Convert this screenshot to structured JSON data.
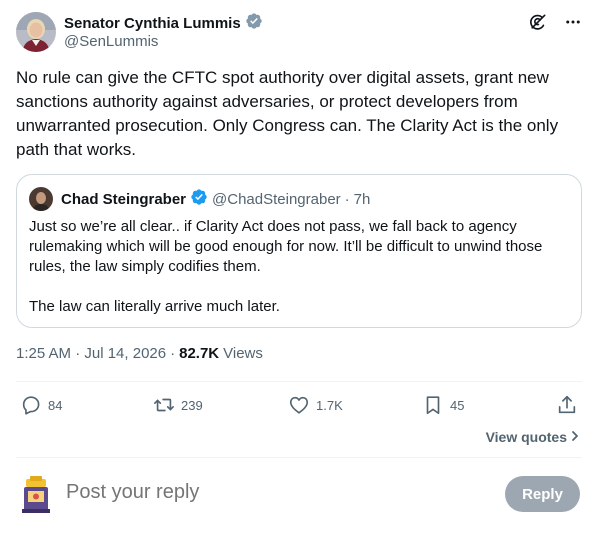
{
  "author": {
    "name": "Senator Cynthia Lummis",
    "handle": "@SenLummis"
  },
  "tweet": {
    "text": "No rule can give the CFTC spot authority over digital assets, grant new sanctions authority against adversaries, or protect developers from unwarranted prosecution. Only Congress can. The Clarity Act is the only path that works."
  },
  "quote": {
    "name": "Chad Steingraber",
    "handle": "@ChadSteingraber",
    "separator": "·",
    "time": "7h",
    "paragraph1": "Just so we’re all clear.. if Clarity Act does not pass, we fall back to agency rulemaking which will be good enough for now.  It’ll be difficult to unwind those rules, the law simply codifies them.",
    "paragraph2": "The law can literally arrive much later."
  },
  "meta": {
    "timestamp": "1:25 AM · Jul 14, 2026",
    "separator": "·",
    "views_count": "82.7K",
    "views_label": "Views"
  },
  "actions": {
    "replies": "84",
    "reposts": "239",
    "likes": "1.7K",
    "bookmarks": "45",
    "view_quotes": "View quotes"
  },
  "reply": {
    "placeholder": "Post your reply",
    "button_label": "Reply"
  },
  "colors": {
    "verified_badge_gray": "#829aab",
    "verified_badge_blue": "#1d9bf0",
    "secondary_text": "#536471",
    "border": "#cfd9de"
  },
  "icons": {
    "grok": "grok-icon",
    "more": "more-icon",
    "reply": "reply-icon",
    "repost": "repost-icon",
    "like": "like-icon",
    "bookmark": "bookmark-icon",
    "share": "share-icon",
    "chevron": "chevron-right-icon"
  }
}
